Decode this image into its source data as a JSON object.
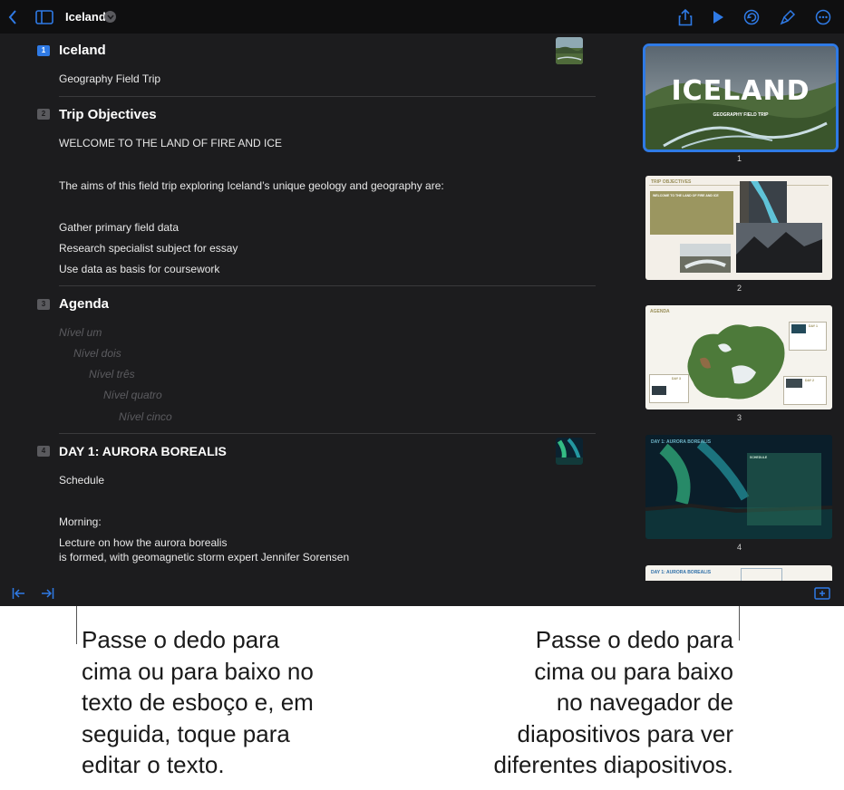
{
  "toolbar": {
    "title": "Iceland",
    "icons": [
      "back-chevron-icon",
      "sidebar-icon",
      "chevron-down-icon",
      "share-icon",
      "play-icon",
      "undo-icon",
      "format-brush-icon",
      "more-icon"
    ]
  },
  "outline": {
    "slides": [
      {
        "number": "1",
        "title": "Iceland",
        "lines": [
          "Geography Field Trip"
        ]
      },
      {
        "number": "2",
        "title": "Trip Objectives",
        "lines": [
          "WELCOME TO THE LAND OF FIRE AND ICE",
          "The aims of this field trip exploring Iceland’s unique geology and geography are:",
          "Gather primary field data",
          "Research specialist subject for essay",
          "Use data as basis for coursework"
        ]
      },
      {
        "number": "3",
        "title": "Agenda",
        "levels": [
          "Nível um",
          "Nível dois",
          "Nível três",
          "Nível quatro",
          "Nível cinco"
        ]
      },
      {
        "number": "4",
        "title": "DAY 1: AURORA BOREALIS",
        "lines": [
          "Schedule",
          "Morning:",
          "Lecture on how the aurora borealis",
          "is formed, with geomagnetic storm expert Jennifer Sorensen"
        ]
      }
    ]
  },
  "navigator": {
    "slide1": {
      "title": "ICELAND",
      "subtitle": "GEOGRAPHY FIELD TRIP",
      "number": "1"
    },
    "slide2": {
      "title": "TRIP OBJECTIVES",
      "box_heading": "WELCOME TO THE LAND OF FIRE AND ICE",
      "number": "2"
    },
    "slide3": {
      "title": "AGENDA",
      "day1": "DAY 1",
      "day2": "DAY 2",
      "day3": "DAY 3",
      "number": "3"
    },
    "slide4": {
      "title": "DAY 1: AURORA BOREALIS",
      "box_heading": "SCHEDULE",
      "number": "4"
    },
    "slide5": {
      "title": "DAY 1: AURORA BOREALIS"
    }
  },
  "captions": {
    "left": [
      "Passe o dedo para",
      "cima ou para baixo no",
      "texto de esboço e, em",
      "seguida, toque para",
      "editar o texto."
    ],
    "right": [
      "Passe o dedo para",
      "cima ou para baixo",
      "no navegador de",
      "diapositivos para ver",
      "diferentes diapositivos."
    ]
  },
  "colors": {
    "accent": "#2f7ae5",
    "app_bg": "#1c1c1e",
    "toolbar_bg": "#0f0f10"
  }
}
